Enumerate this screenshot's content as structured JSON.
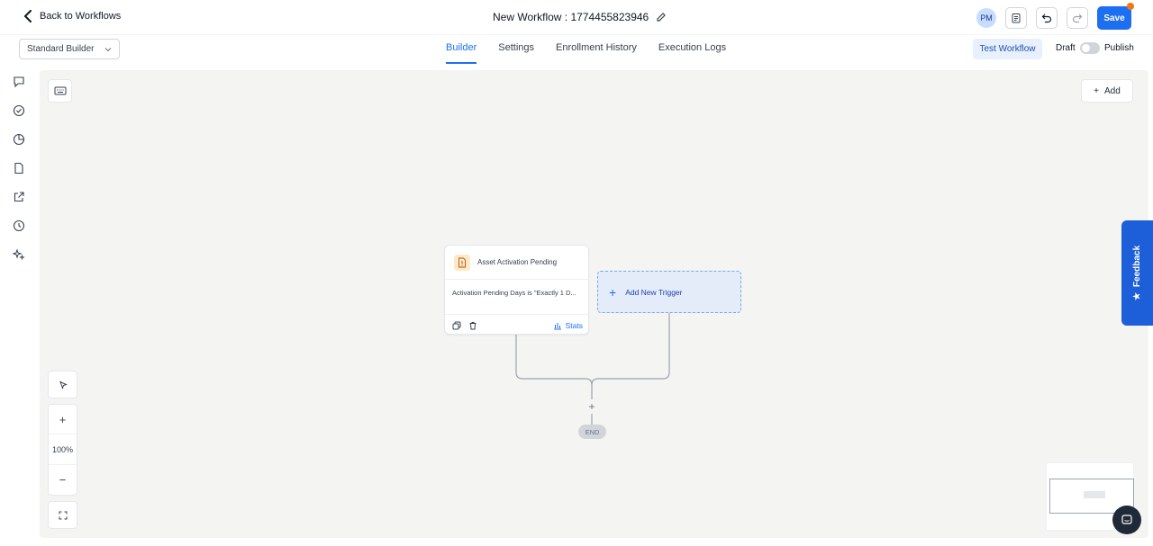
{
  "header": {
    "back_label": "Back to Workflows",
    "workflow_title": "New Workflow : 1774455823946",
    "avatar_initials": "PM",
    "save_label": "Save"
  },
  "subbar": {
    "builder_select_value": "Standard Builder",
    "tabs": [
      {
        "label": "Builder",
        "active": true
      },
      {
        "label": "Settings",
        "active": false
      },
      {
        "label": "Enrollment History",
        "active": false
      },
      {
        "label": "Execution Logs",
        "active": false
      }
    ],
    "test_workflow_label": "Test Workflow",
    "draft_label": "Draft",
    "publish_label": "Publish",
    "publish_enabled": false
  },
  "leftrail": {
    "icons": [
      "chat-icon",
      "check-circle-icon",
      "pie-chart-icon",
      "document-icon",
      "external-link-icon",
      "history-icon",
      "sparkle-icon"
    ]
  },
  "canvas": {
    "add_label": "Add",
    "trigger": {
      "title": "Asset Activation Pending",
      "condition": "Activation Pending Days is \"Exactly 1 D...",
      "stats_label": "Stats"
    },
    "add_trigger_label": "Add New Trigger",
    "end_label": "END",
    "zoom_level": "100%"
  },
  "feedback": {
    "label": "Feedback"
  },
  "colors": {
    "accent": "#1d6ff2",
    "canvas_bg": "#f4f4f3",
    "feedback_bg": "#1d5fd8",
    "save_badge": "#f97316"
  }
}
